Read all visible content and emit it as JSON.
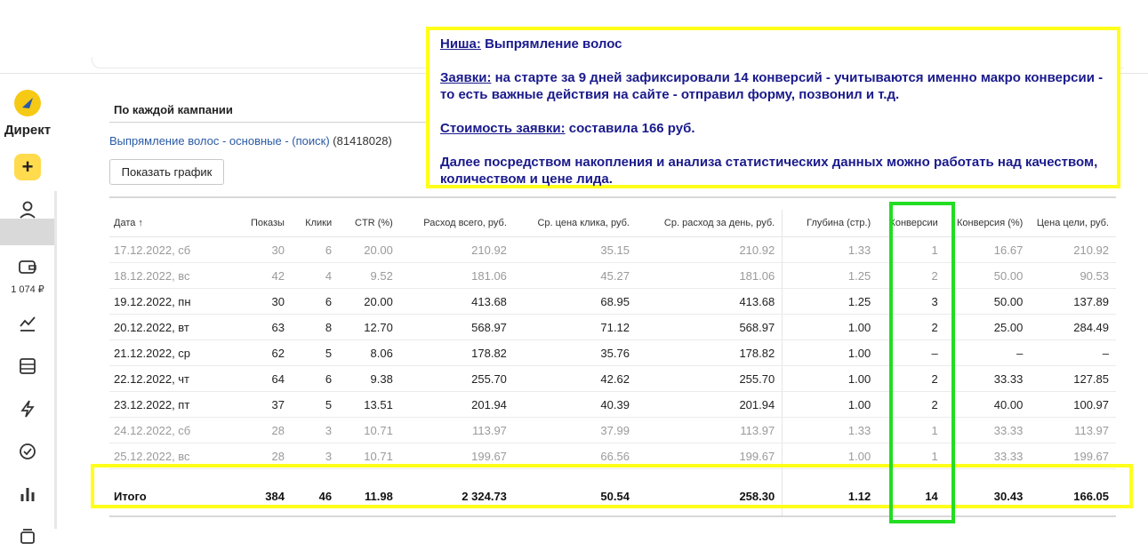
{
  "sidebar": {
    "logo_label": "Директ",
    "add_label": "+",
    "balance": "1 074 ₽",
    "icons": [
      "user-icon",
      "wallet-icon",
      "stats-icon",
      "list-icon",
      "lightning-icon",
      "check-circle-icon",
      "bar-chart-icon",
      "layers-icon"
    ]
  },
  "section": {
    "title": "По каждой кампании",
    "campaign_link": "Выпрямление волос - основные - (поиск)",
    "campaign_id": "(81418028)",
    "chart_button": "Показать график"
  },
  "table": {
    "headers": [
      "Дата ↑",
      "Показы",
      "Клики",
      "CTR (%)",
      "Расход всего, руб.",
      "Ср. цена клика, руб.",
      "Ср. расход за день, руб.",
      "Глубина (стр.)",
      "Конверсии",
      "Конверсия (%)",
      "Цена цели, руб."
    ],
    "rows": [
      {
        "muted": true,
        "cells": [
          "17.12.2022, сб",
          "30",
          "6",
          "20.00",
          "210.92",
          "35.15",
          "210.92",
          "1.33",
          "1",
          "16.67",
          "210.92"
        ]
      },
      {
        "muted": true,
        "cells": [
          "18.12.2022, вс",
          "42",
          "4",
          "9.52",
          "181.06",
          "45.27",
          "181.06",
          "1.25",
          "2",
          "50.00",
          "90.53"
        ]
      },
      {
        "muted": false,
        "cells": [
          "19.12.2022, пн",
          "30",
          "6",
          "20.00",
          "413.68",
          "68.95",
          "413.68",
          "1.25",
          "3",
          "50.00",
          "137.89"
        ]
      },
      {
        "muted": false,
        "cells": [
          "20.12.2022, вт",
          "63",
          "8",
          "12.70",
          "568.97",
          "71.12",
          "568.97",
          "1.00",
          "2",
          "25.00",
          "284.49"
        ]
      },
      {
        "muted": false,
        "cells": [
          "21.12.2022, ср",
          "62",
          "5",
          "8.06",
          "178.82",
          "35.76",
          "178.82",
          "1.00",
          "–",
          "–",
          "–"
        ]
      },
      {
        "muted": false,
        "cells": [
          "22.12.2022, чт",
          "64",
          "6",
          "9.38",
          "255.70",
          "42.62",
          "255.70",
          "1.00",
          "2",
          "33.33",
          "127.85"
        ]
      },
      {
        "muted": false,
        "cells": [
          "23.12.2022, пт",
          "37",
          "5",
          "13.51",
          "201.94",
          "40.39",
          "201.94",
          "1.00",
          "2",
          "40.00",
          "100.97"
        ]
      },
      {
        "muted": true,
        "cells": [
          "24.12.2022, сб",
          "28",
          "3",
          "10.71",
          "113.97",
          "37.99",
          "113.97",
          "1.33",
          "1",
          "33.33",
          "113.97"
        ]
      },
      {
        "muted": true,
        "cells": [
          "25.12.2022, вс",
          "28",
          "3",
          "10.71",
          "199.67",
          "66.56",
          "199.67",
          "1.00",
          "1",
          "33.33",
          "199.67"
        ]
      }
    ],
    "total": [
      "Итого",
      "384",
      "46",
      "11.98",
      "2 324.73",
      "50.54",
      "258.30",
      "1.12",
      "14",
      "30.43",
      "166.05"
    ]
  },
  "note": {
    "niche_label": "Ниша:",
    "niche_text": " Выпрямление волос",
    "leads_label": "Заявки:",
    "leads_text": " на старте за 9 дней зафиксировали 14 конверсий - учитываются именно макро конверсии - то есть важные действия на сайте - отправил форму, позвонил и т.д.",
    "cost_label": "Стоимость заявки:",
    "cost_text": " составила 166 руб.",
    "further_text": "Далее посредством накопления и анализа статистических данных можно работать над качеством, количеством и цене лида."
  },
  "colors": {
    "highlight_yellow": "#ffff1a",
    "highlight_green": "#22dd22",
    "note_text": "#1a1a8c",
    "link": "#2a5aa6",
    "logo_yellow": "#f6c915"
  }
}
